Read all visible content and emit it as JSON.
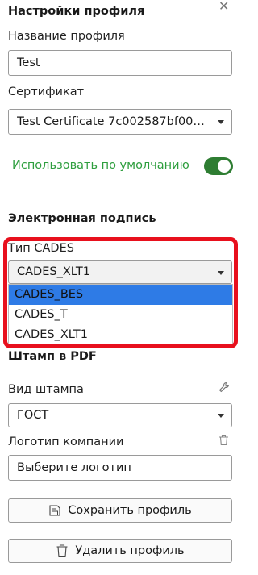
{
  "header": {
    "title": "Настройки профиля",
    "close_icon": "close-icon"
  },
  "profile_name": {
    "label": "Название профиля",
    "value": "Test"
  },
  "certificate": {
    "label": "Сертификат",
    "value": "Test Certificate 7c002587bf00ca..."
  },
  "default_toggle": {
    "label": "Использовать по умолчанию",
    "state": "on",
    "color": "#2e7d32"
  },
  "signature": {
    "heading": "Электронная подпись",
    "cades_label": "Тип CADES",
    "cades_value": "CADES_XLT1",
    "options": [
      "CADES_BES",
      "CADES_T",
      "CADES_XLT1"
    ],
    "highlighted_option": "CADES_BES"
  },
  "stamp": {
    "heading": "Штамп в PDF",
    "type_label": "Вид штампа",
    "type_value": "ГОСТ",
    "logo_label": "Логотип компании",
    "logo_placeholder": "Выберите логотип"
  },
  "buttons": {
    "save": "Сохранить профиль",
    "delete": "Удалить профиль"
  },
  "colors": {
    "highlight": "#e8101d",
    "selection": "#2e7be6",
    "toggle_label": "#2e9e3e"
  }
}
